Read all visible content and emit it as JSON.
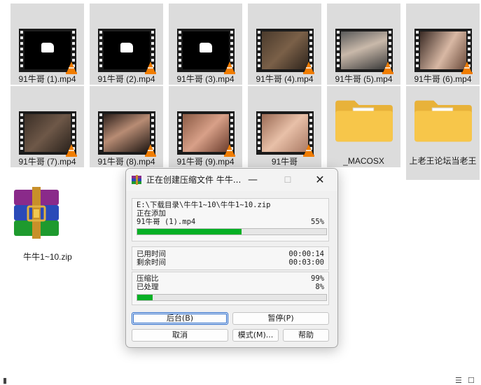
{
  "files": [
    {
      "name": "91牛哥 (1).mp4",
      "thumb": "black"
    },
    {
      "name": "91牛哥 (2).mp4",
      "thumb": "black"
    },
    {
      "name": "91牛哥 (3).mp4",
      "thumb": "black"
    },
    {
      "name": "91牛哥 (4).mp4",
      "thumb": "room"
    },
    {
      "name": "91牛哥 (5).mp4",
      "thumb": "photo"
    },
    {
      "name": "91牛哥 (6).mp4",
      "thumb": "face"
    },
    {
      "name": "91牛哥 (7).mp4",
      "thumb": "room"
    },
    {
      "name": "91牛哥 (8).mp4",
      "thumb": "face"
    },
    {
      "name": "91牛哥 (9).mp4",
      "thumb": "skin"
    },
    {
      "name": "91牛哥",
      "thumb": "skin"
    }
  ],
  "folders": [
    {
      "name": "_MACOSX"
    },
    {
      "name": "上老王论坛当老王"
    }
  ],
  "zip": {
    "name": "牛牛1~10.zip"
  },
  "dialog": {
    "title": "正在创建压缩文件 牛牛...",
    "path": "E:\\下载目录\\牛牛1~10\\牛牛1~10.zip",
    "status": "正在添加",
    "current_file": "91牛哥 (1).mp4",
    "file_percent_label": "55%",
    "file_progress": 0.55,
    "elapsed_label": "已用时间",
    "elapsed_value": "00:00:14",
    "remaining_label": "剩余时间",
    "remaining_value": "00:03:00",
    "ratio_label": "压缩比",
    "ratio_value": "99%",
    "processed_label": "已处理",
    "processed_value": "8%",
    "total_progress": 0.08,
    "buttons": {
      "background": "后台(B)",
      "pause": "暂停(P)",
      "cancel": "取消",
      "mode": "模式(M)...",
      "help": "帮助"
    }
  },
  "colors": {
    "progress": "#06b025",
    "thumb_bg": "#dcdcdc"
  }
}
